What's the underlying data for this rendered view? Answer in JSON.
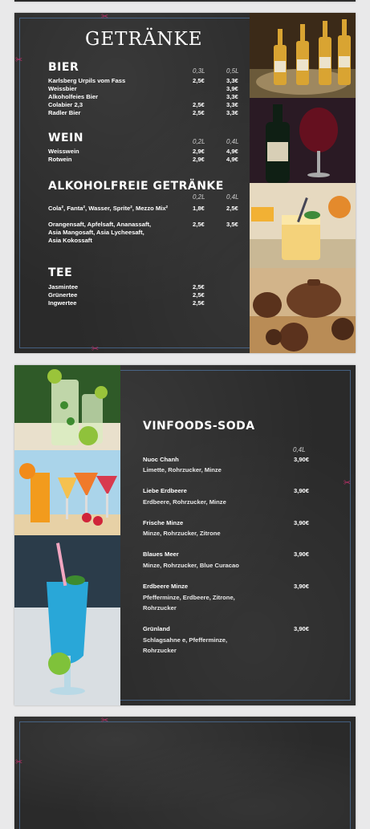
{
  "menu": {
    "title": "GETRÄNKE",
    "bier": {
      "heading": "BIER",
      "units": [
        "0,3L",
        "0,5L"
      ],
      "items": [
        {
          "name": "Karlsberg Urpils vom Fass",
          "p1": "2,5€",
          "p2": "3,3€"
        },
        {
          "name": "Weissbier",
          "p1": "",
          "p2": "3,9€"
        },
        {
          "name": "Alkoholfeies Bier",
          "p1": "",
          "p2": "3,3€"
        },
        {
          "name": "Colabier 2,3",
          "p1": "2,5€",
          "p2": "3,3€"
        },
        {
          "name": "Radler Bier",
          "p1": "2,5€",
          "p2": "3,3€"
        }
      ]
    },
    "wein": {
      "heading": "WEIN",
      "units": [
        "0,2L",
        "0,4L"
      ],
      "items": [
        {
          "name": "Weisswein",
          "p1": "2,9€",
          "p2": "4,9€"
        },
        {
          "name": "Rotwein",
          "p1": "2,9€",
          "p2": "4,9€"
        }
      ]
    },
    "alkoholfrei": {
      "heading": "ALKOHOLFREIE GETRÄNKE",
      "units": [
        "0,2L",
        "0,4L"
      ],
      "items": [
        {
          "name": "Cola², Fanta², Wasser, Sprite², Mezzo Mix²",
          "p1": "1,8€",
          "p2": "2,5€"
        },
        {
          "name": "Orangensaft, Apfelsaft, Ananassaft,",
          "p1": "2,5€",
          "p2": "3,5€"
        },
        {
          "name": "Asia Mangosaft, Asia Lycheesaft,",
          "p1": "",
          "p2": ""
        },
        {
          "name": "Asia Kokossaft",
          "p1": "",
          "p2": ""
        }
      ]
    },
    "tee": {
      "heading": "TEE",
      "items": [
        {
          "name": "Jasmintee",
          "p1": "2,5€"
        },
        {
          "name": "Grünertee",
          "p1": "2,5€"
        },
        {
          "name": "Ingwertee",
          "p1": "2,5€"
        }
      ]
    }
  },
  "soda": {
    "heading": "VINFOODS-SODA",
    "unit": "0,4L",
    "items": [
      {
        "name": "Nuoc Chanh",
        "desc": "Limette, Rohrzucker, Minze",
        "price": "3,90€"
      },
      {
        "name": "Liebe Erdbeere",
        "desc": "Erdbeere, Rohrzucker, Minze",
        "price": "3,90€"
      },
      {
        "name": "Frische Minze",
        "desc": "Minze, Rohrzucker, Zitrone",
        "price": "3,90€"
      },
      {
        "name": "Blaues Meer",
        "desc": "Minze, Rohrzucker, Blue Curacao",
        "price": "3,90€"
      },
      {
        "name": "Erdbeere Minze",
        "desc": "Pfefferminze, Erdbeere, Zitrone, Rohrzucker",
        "price": "3,90€"
      },
      {
        "name": "Grünland",
        "desc": "Schlagsahne e, Pfefferminze, Rohrzucker",
        "price": "3,90€"
      }
    ]
  },
  "colors": {
    "chalkboard": "#2a2a2a",
    "accent": "#c0306b",
    "frame": "#5a8cc8"
  }
}
